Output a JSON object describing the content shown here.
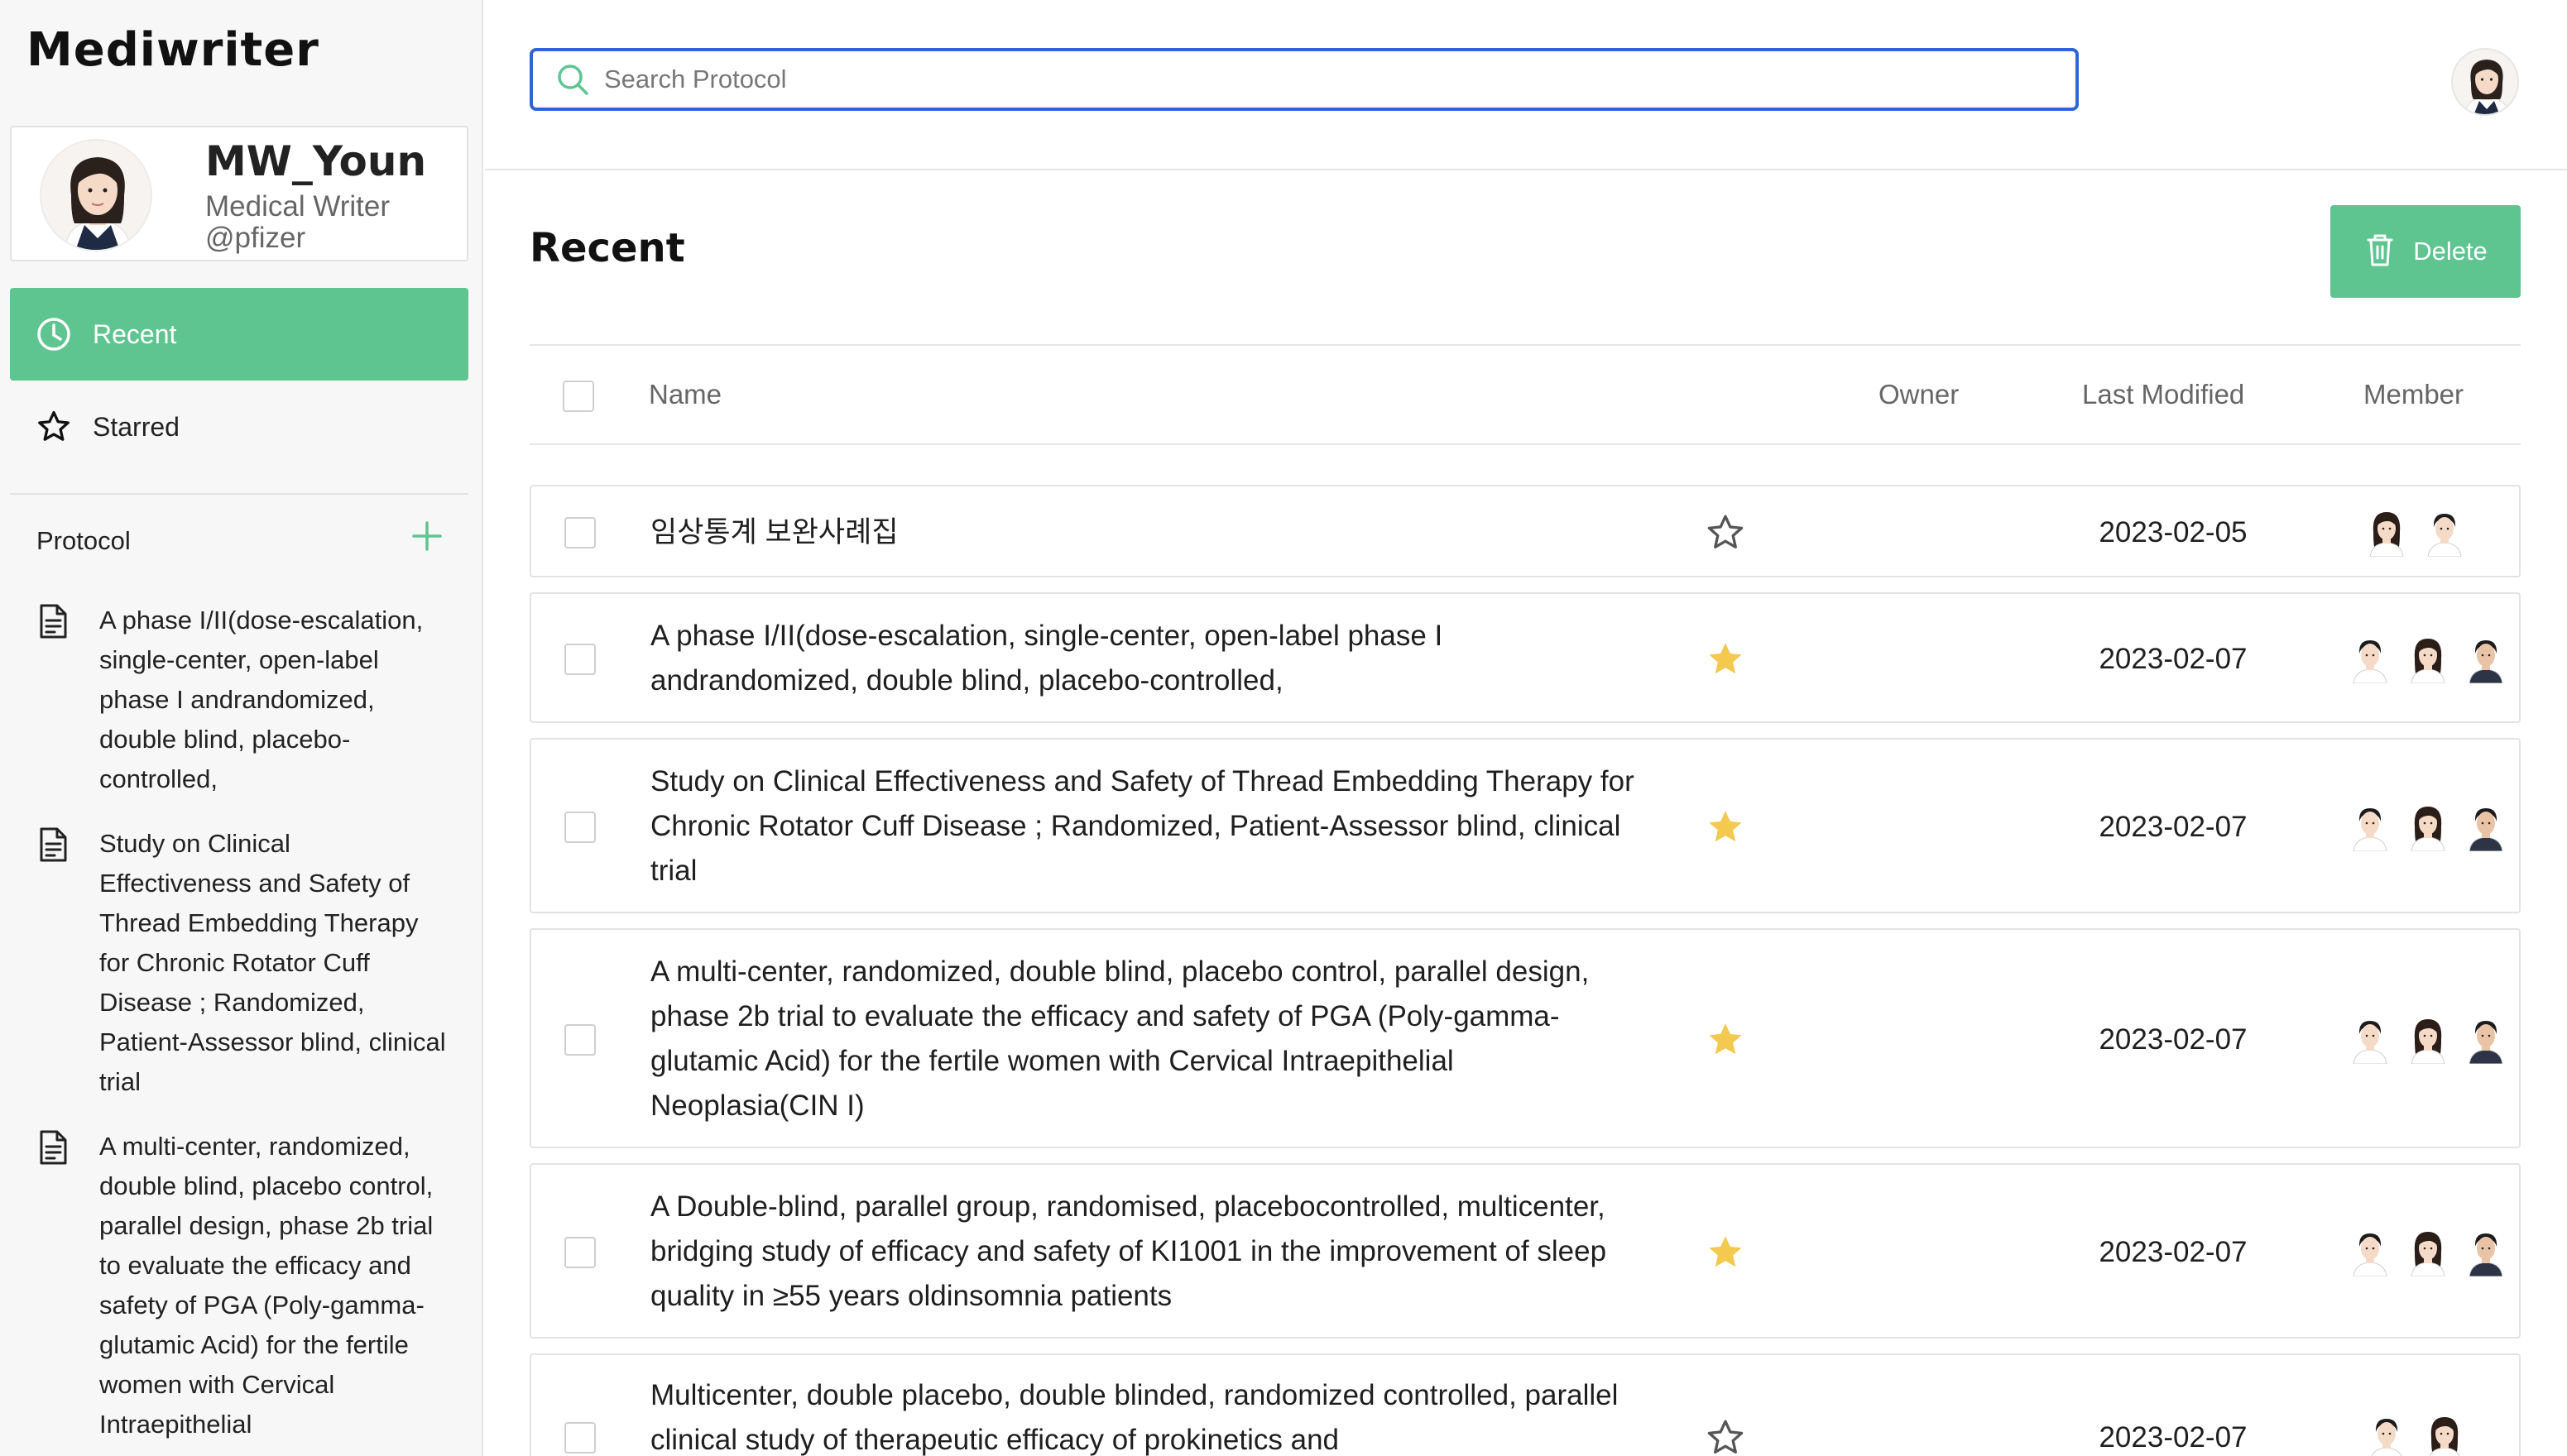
{
  "app": {
    "logo": "Mediwriter"
  },
  "profile": {
    "name": "MW_Youn",
    "role": "Medical Writer",
    "org": "@pfizer"
  },
  "nav": {
    "recent": "Recent",
    "starred": "Starred"
  },
  "sidebar": {
    "protocol_header": "Protocol",
    "items": [
      {
        "label": "A phase I/II(dose-escalation, single-center, open-label phase I andrandomized, double blind, placebo-controlled,"
      },
      {
        "label": "Study on Clinical Effectiveness and Safety of Thread Embedding Therapy for Chronic Rotator Cuff Disease ; Randomized, Patient-Assessor blind, clinical trial"
      },
      {
        "label": "A multi-center, randomized, double blind, placebo control, parallel design, phase 2b trial to evaluate the efficacy and safety of PGA (Poly-gamma-glutamic Acid) for the fertile women with Cervical Intraepithelial"
      }
    ]
  },
  "search": {
    "placeholder": "Search Protocol"
  },
  "main": {
    "title": "Recent",
    "delete_label": "Delete",
    "columns": {
      "name": "Name",
      "owner": "Owner",
      "last_modified": "Last Modified",
      "member": "Member"
    },
    "rows": [
      {
        "name": "임상통계 보완사례집",
        "starred": false,
        "date": "2023-02-05",
        "members": [
          "female",
          "male-light"
        ]
      },
      {
        "name": "A phase I/II(dose-escalation, single-center, open-label phase I andrandomized, double blind, placebo-controlled,",
        "starred": true,
        "date": "2023-02-07",
        "members": [
          "male-light",
          "female",
          "male-dark"
        ]
      },
      {
        "name": "Study on Clinical Effectiveness and Safety of Thread Embedding Therapy for Chronic Rotator Cuff Disease ; Randomized, Patient-Assessor blind, clinical trial",
        "starred": true,
        "date": "2023-02-07",
        "members": [
          "male-light",
          "female",
          "male-dark"
        ]
      },
      {
        "name": "A multi-center, randomized, double blind, placebo control, parallel design, phase 2b trial to evaluate the efficacy and safety of PGA (Poly-gamma-glutamic Acid) for the fertile women with Cervical Intraepithelial Neoplasia(CIN I)",
        "starred": true,
        "date": "2023-02-07",
        "members": [
          "male-light",
          "female",
          "male-dark"
        ]
      },
      {
        "name": "A Double-blind, parallel group, randomised, placebocontrolled, multicenter, bridging study of efficacy and safety of KI1001 in the improvement of sleep quality in ≥55 years oldinsomnia patients",
        "starred": true,
        "date": "2023-02-07",
        "members": [
          "male-light",
          "female",
          "male-dark"
        ]
      },
      {
        "name": "Multicenter, double placebo, double blinded, randomized controlled, parallel clinical study of therapeutic efficacy of prokinetics and",
        "starred": false,
        "date": "2023-02-07",
        "members": [
          "male-light",
          "female"
        ]
      }
    ]
  },
  "colors": {
    "accent": "#5ec591",
    "star": "#f3c94f",
    "search_border": "#2f64d6"
  }
}
